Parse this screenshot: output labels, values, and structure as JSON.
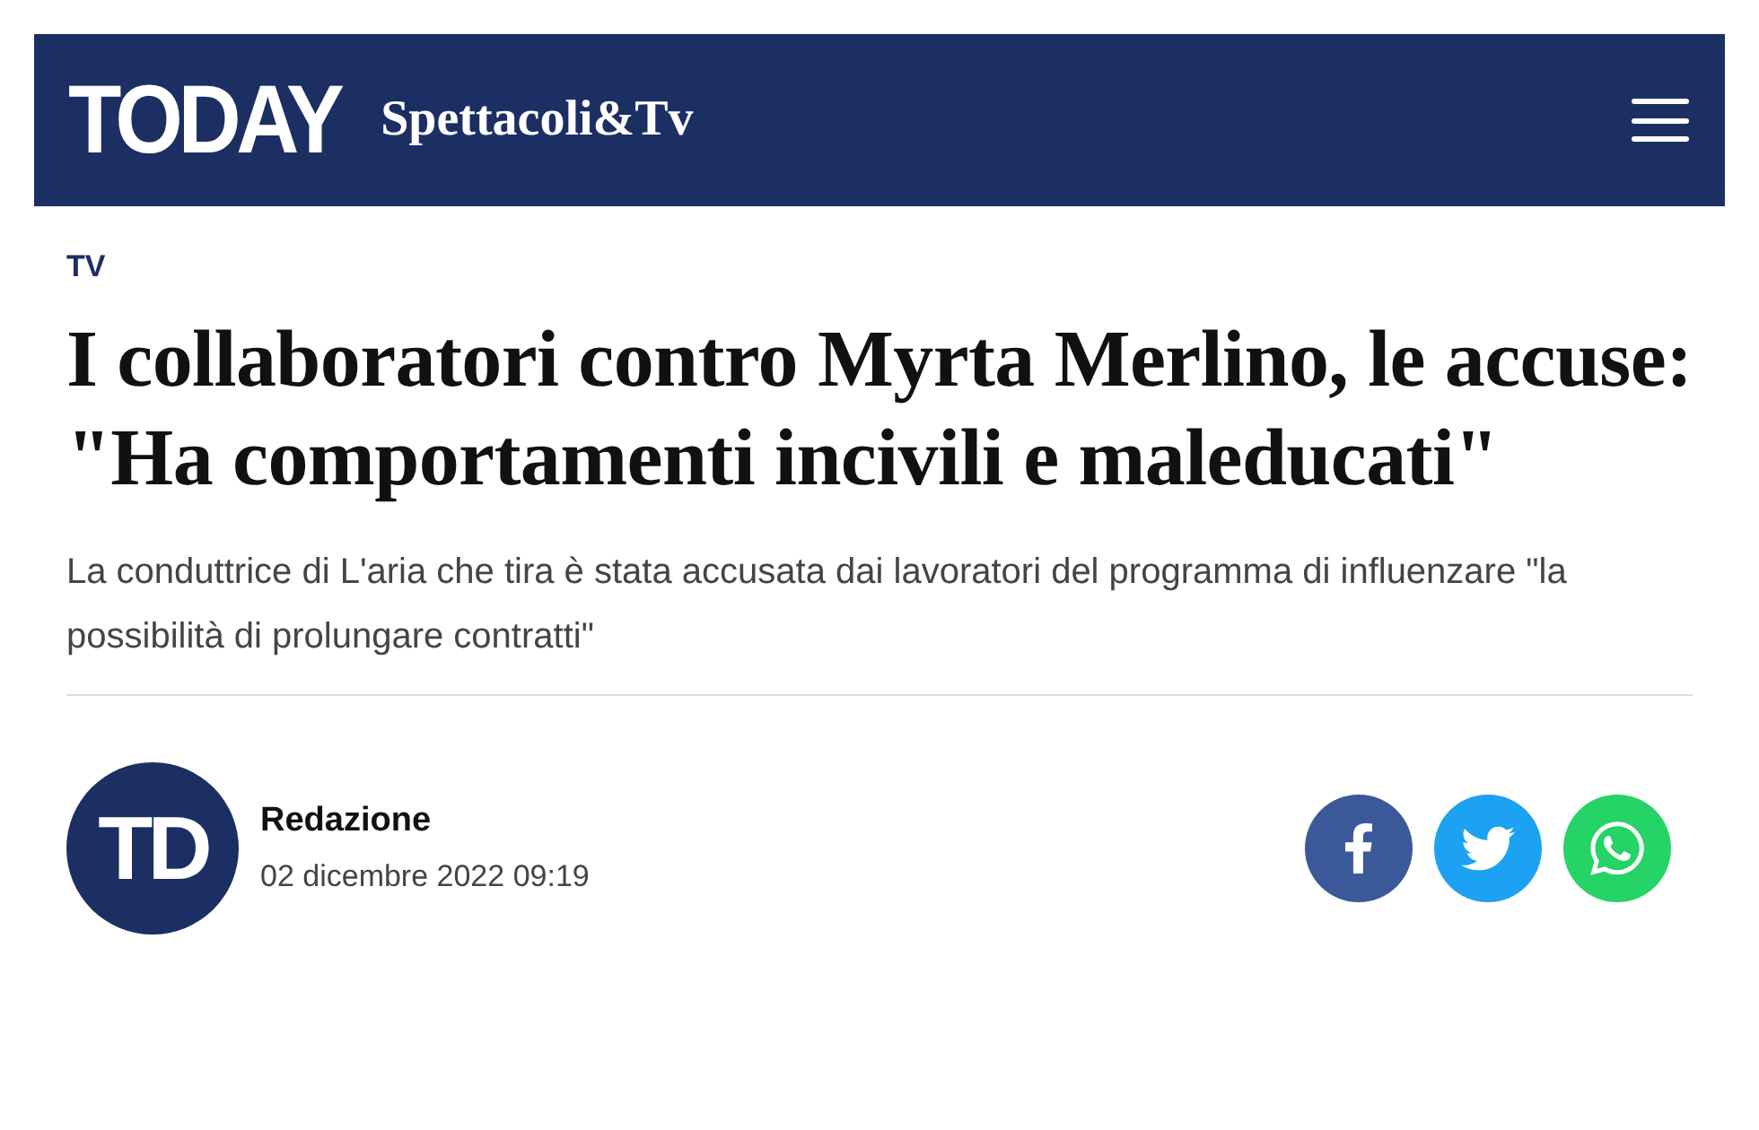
{
  "header": {
    "logo": "TODAY",
    "section": "Spettacoli&Tv"
  },
  "article": {
    "category": "TV",
    "title": "I collaboratori contro Myrta Merlino, le accuse: \"Ha comportamenti incivili e maleducati\"",
    "subtitle": "La conduttrice di L'aria che tira è stata accusata dai lavoratori del programma di influenzare \"la possibilità di prolungare contratti\""
  },
  "author": {
    "initials": "TD",
    "name": "Redazione",
    "date": "02 dicembre 2022 09:19"
  },
  "share": [
    {
      "kind": "facebook",
      "color": "#3b5998"
    },
    {
      "kind": "twitter",
      "color": "#1da1f2"
    },
    {
      "kind": "whatsapp",
      "color": "#25d366"
    }
  ]
}
